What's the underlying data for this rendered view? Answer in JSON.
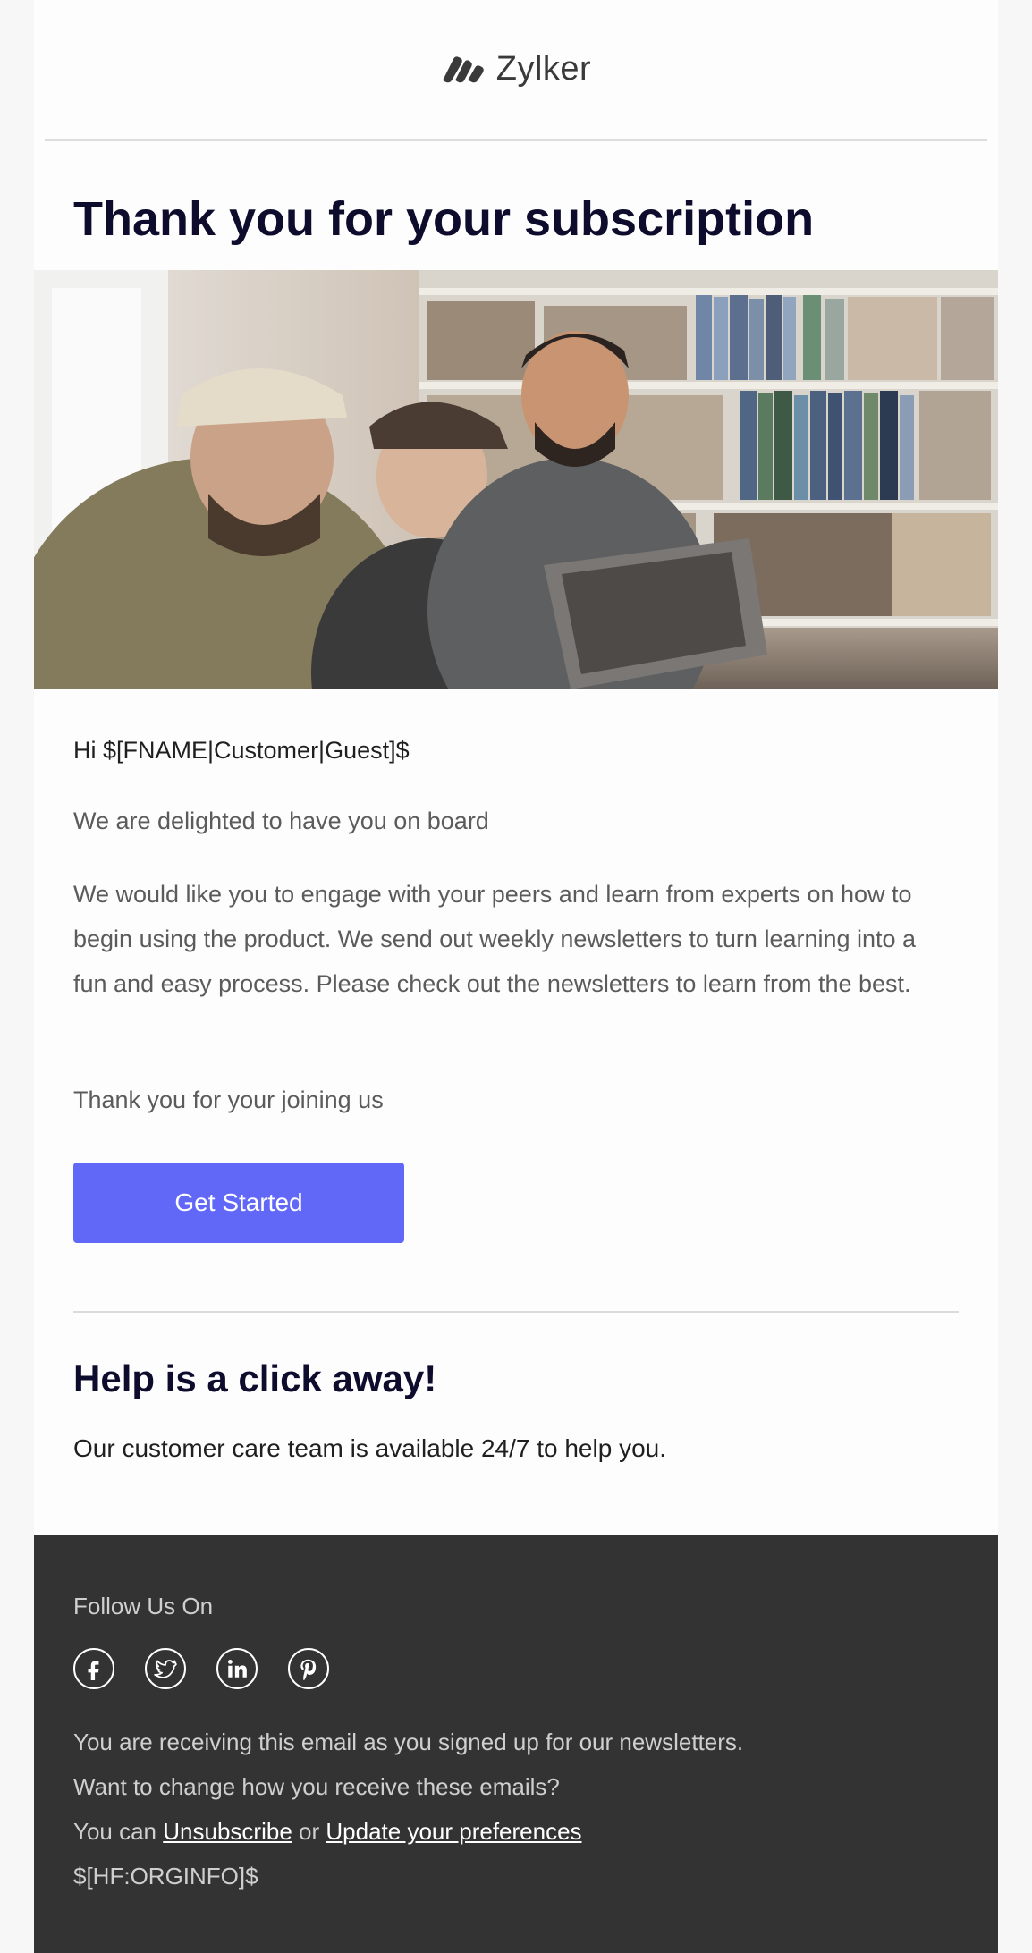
{
  "header": {
    "brand_name": "Zylker"
  },
  "main": {
    "title": "Thank you for your subscription",
    "greeting": "Hi $[FNAME|Customer|Guest]$",
    "paragraphs": [
      "We are delighted to have you on board",
      "We would like you to engage with your peers and learn from experts on how to begin using the product. We send out weekly newsletters to turn learning into a fun and easy process. Please check out the newsletters to learn from the best.",
      "Thank you for your joining us"
    ],
    "cta_label": "Get Started",
    "cta_color": "#6168f7"
  },
  "help": {
    "title": "Help is a click away!",
    "text": "Our customer care team is available 24/7 to help you."
  },
  "footer": {
    "follow_label": "Follow Us On",
    "social_icons": [
      "facebook-icon",
      "twitter-icon",
      "linkedin-icon",
      "pinterest-icon"
    ],
    "receiving_text": "You are receiving this email as you signed up for our newsletters.",
    "change_text": "Want to change how you receive these emails?",
    "you_can": "You can",
    "unsubscribe_label": "Unsubscribe",
    "or_text": "or",
    "preferences_label": "Update your preferences",
    "org_info": "$[HF:ORGINFO]$",
    "background_color": "#333333"
  }
}
